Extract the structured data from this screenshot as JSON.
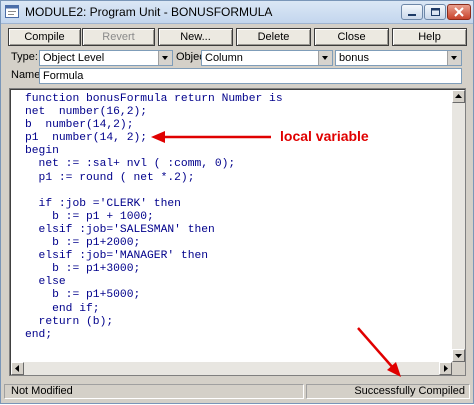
{
  "window": {
    "title": "MODULE2: Program Unit - BONUSFORMULA"
  },
  "toolbar": {
    "buttons": [
      {
        "label": "Compile",
        "enabled": true
      },
      {
        "label": "Revert",
        "enabled": false
      },
      {
        "label": "New...",
        "enabled": true
      },
      {
        "label": "Delete",
        "enabled": true
      },
      {
        "label": "Close",
        "enabled": true
      },
      {
        "label": "Help",
        "enabled": true
      }
    ]
  },
  "filters": {
    "type_label": "Type:",
    "type_value": "Object Level",
    "object_label": "Object:",
    "object_value": "Column",
    "object_extra_value": "bonus",
    "name_label": "Name:",
    "name_value": "Formula"
  },
  "editor": {
    "lines": [
      "function bonusFormula return Number is",
      "net  number(16,2);",
      "b  number(14,2);",
      "p1  number(14, 2);",
      "begin",
      "  net := :sal+ nvl ( :comm, 0);",
      "  p1 := round ( net *.2);",
      "",
      "  if :job ='CLERK' then",
      "    b := p1 + 1000;",
      "  elsif :job='SALESMAN' then",
      "    b := p1+2000;",
      "  elsif :job='MANAGER' then",
      "    b := p1+3000;",
      "  else",
      "    b := p1+5000;",
      "    end if;",
      "  return (b);",
      "end;"
    ]
  },
  "annotations": {
    "local_variable": "local variable"
  },
  "statusbar": {
    "left": "Not Modified",
    "right": "Successfully Compiled"
  },
  "colors": {
    "code_text": "#00008b",
    "annotation": "#e00000",
    "chrome": "#d4d0c8"
  }
}
